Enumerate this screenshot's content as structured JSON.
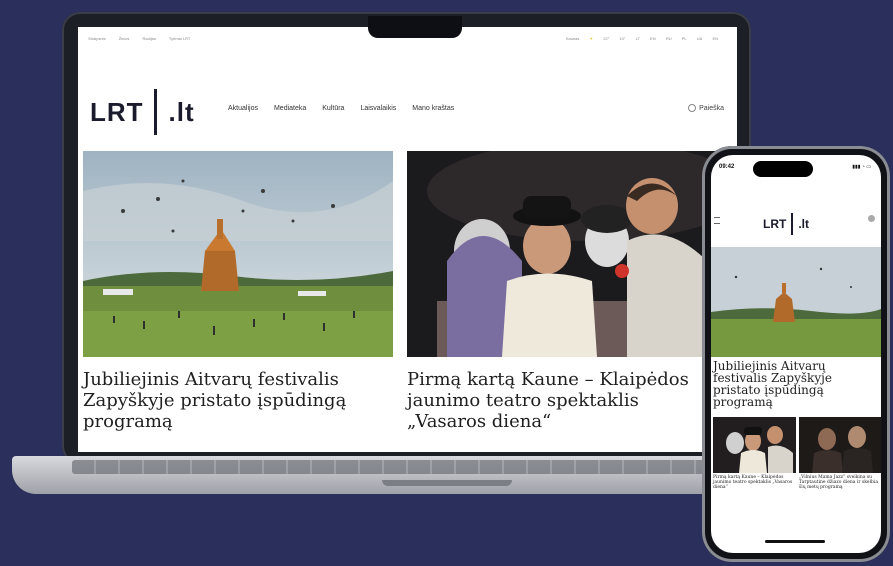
{
  "topbar": {
    "left_items": [
      "Straipsnis",
      "Žinios",
      "Radijas",
      "Tyrimai LRT"
    ],
    "right_items": [
      "Kaunas",
      "22°",
      "10°",
      "LT",
      "EN",
      "RU",
      "PL",
      "UA",
      "EN"
    ]
  },
  "logo": {
    "brand": "LRT",
    "domain": ".lt"
  },
  "nav": {
    "items": [
      "Aktualijos",
      "Mediateka",
      "Kultūra",
      "Laisvalaikis",
      "Mano kraštas"
    ]
  },
  "search": {
    "label": "Paieška"
  },
  "articles": [
    {
      "title": "Jubiliejinis Aitvarų festivalis Zapyškyje pristato įspūdingą programą"
    },
    {
      "title": "Pirmą kartą Kaune – Klaipėdos jaunimo teatro spektaklis „Vasaros diena“"
    }
  ],
  "phone": {
    "time": "09:42",
    "brand": "LRT",
    "domain": ".lt",
    "main_title": "Jubiliejinis Aitvarų festivalis Zapyškyje pristato įspūdingą programą",
    "small_articles": [
      {
        "title": "Pirmą kartą Kaune – Klaipėdos jaunimo teatro spektaklis „Vasaros diena“"
      },
      {
        "title": "„Vilnius Mama Jazz“ sveikina su Tarptautine džiazo diena ir skelbia šių metų programą"
      }
    ]
  }
}
